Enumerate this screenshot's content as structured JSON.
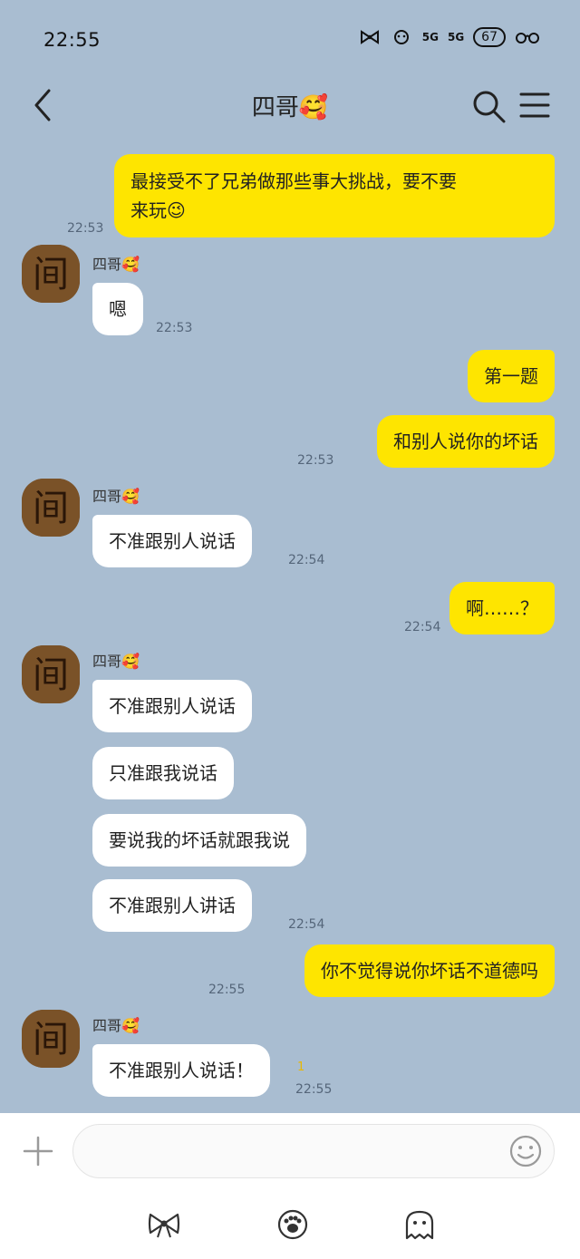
{
  "status_bar": {
    "time": "22:55",
    "net1": "5G",
    "net2": "5G",
    "battery": "67"
  },
  "header": {
    "title": "四哥🥰"
  },
  "messages": [
    {
      "from": "me",
      "text_line1": "最接受不了兄弟做那些事大挑战，要不要",
      "text_line2": "来玩😉",
      "time": "22:53"
    },
    {
      "from": "other",
      "sender": "四哥🥰",
      "text": "嗯",
      "time": "22:53"
    },
    {
      "from": "me",
      "text": "第一题"
    },
    {
      "from": "me",
      "text": "和别人说你的坏话",
      "time": "22:53"
    },
    {
      "from": "other",
      "sender": "四哥🥰",
      "text": "不准跟别人说话",
      "time": "22:54"
    },
    {
      "from": "me",
      "text": "啊……？",
      "time": "22:54"
    },
    {
      "from": "other",
      "sender": "四哥🥰",
      "text": "不准跟别人说话"
    },
    {
      "from": "other",
      "text": "只准跟我说话"
    },
    {
      "from": "other",
      "text": "要说我的坏话就跟我说"
    },
    {
      "from": "other",
      "text": "不准跟别人讲话",
      "time": "22:54"
    },
    {
      "from": "me",
      "text": "你不觉得说你坏话不道德吗",
      "time": "22:55"
    },
    {
      "from": "other",
      "sender": "四哥🥰",
      "text": "不准跟别人说话！",
      "unread": "1",
      "time": "22:55"
    }
  ],
  "avatar_glyph": "间",
  "input": {
    "placeholder": ""
  },
  "colors": {
    "chat_background": "#a9bdd1",
    "my_bubble": "#fee500",
    "other_bubble": "#ffffff",
    "unread": "#e8b800"
  },
  "icons": {
    "back": "chevron-left-icon",
    "search": "search-icon",
    "menu": "hamburger-menu-icon",
    "plus": "plus-icon",
    "emoji": "smiley-icon",
    "nav": [
      "bow-icon",
      "paw-icon",
      "ghost-icon"
    ]
  }
}
